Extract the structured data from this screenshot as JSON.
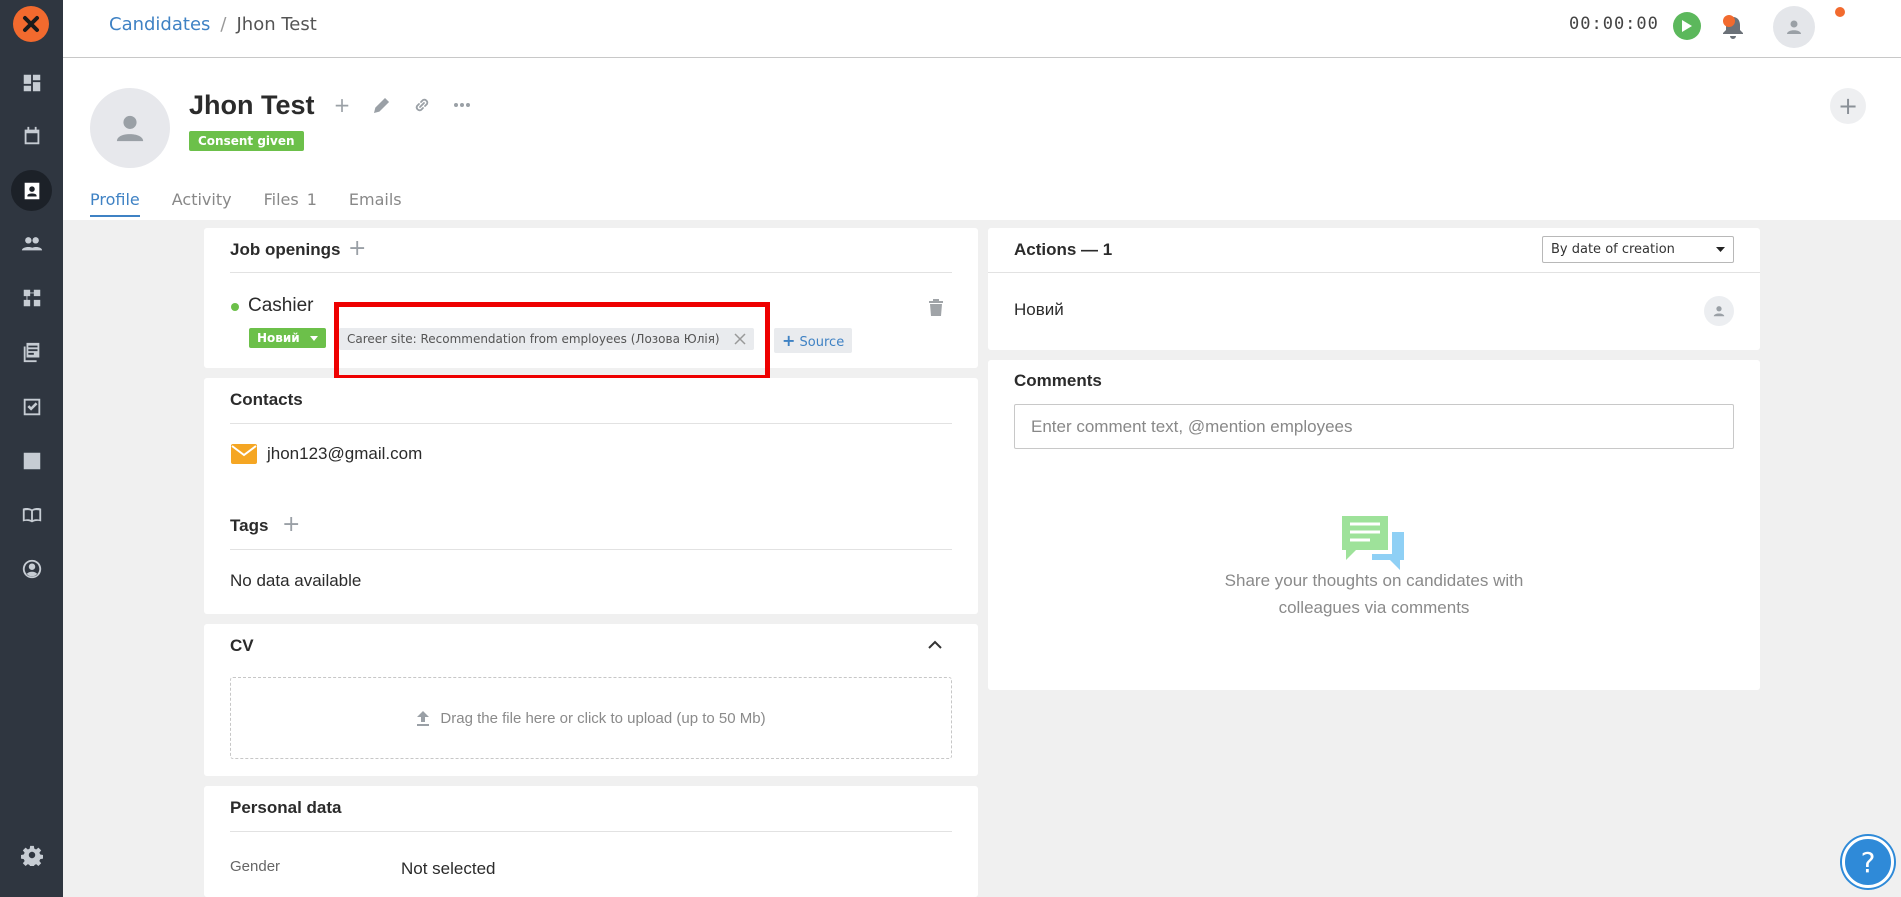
{
  "breadcrumb": {
    "parent": "Candidates",
    "separator": "/",
    "current": "Jhon Test"
  },
  "timer": {
    "value": "00:00:00"
  },
  "candidate": {
    "name": "Jhon Test",
    "consent": "Consent given"
  },
  "tabs": [
    {
      "label": "Profile",
      "count": ""
    },
    {
      "label": "Activity",
      "count": ""
    },
    {
      "label": "Files",
      "count": "1"
    },
    {
      "label": "Emails",
      "count": ""
    }
  ],
  "job_openings": {
    "title": "Job openings",
    "job": {
      "name": "Cashier",
      "stage": "Новий",
      "source": "Career site: Recommendation from employees (Лозова Юлія)",
      "add_source": "Source"
    }
  },
  "contacts": {
    "title": "Contacts",
    "email": "jhon123@gmail.com"
  },
  "tags": {
    "title": "Tags",
    "empty": "No data available"
  },
  "cv": {
    "title": "CV",
    "upload_text": "Drag the file here or click to upload (up to 50 Mb)"
  },
  "personal_data": {
    "title": "Personal data",
    "gender_label": "Gender",
    "gender_value": "Not selected"
  },
  "actions": {
    "title": "Actions — 1",
    "sort_value": "By date of creation",
    "item": "Новий"
  },
  "comments": {
    "title": "Comments",
    "placeholder": "Enter comment text, @mention employees",
    "empty_line1": "Share your thoughts on candidates with",
    "empty_line2": "colleagues via comments"
  },
  "help": {
    "label": "?"
  },
  "colors": {
    "accent": "#3f82c4",
    "success": "#6cc04a",
    "brand": "#f26a2e",
    "highlight": "#ee0000"
  }
}
